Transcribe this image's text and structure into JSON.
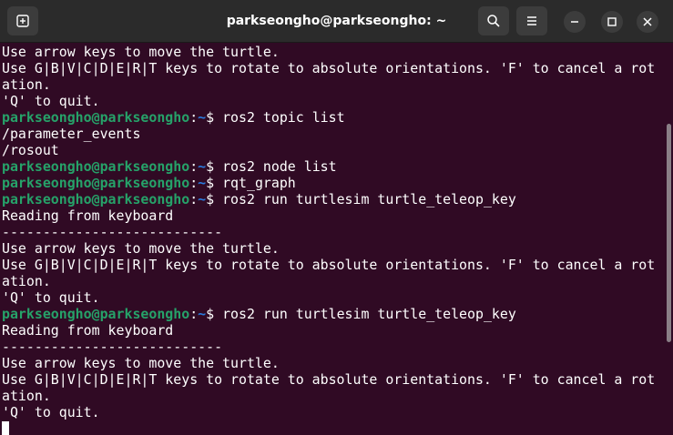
{
  "window": {
    "title": "parkseongho@parkseongho: ~"
  },
  "titlebar": {
    "buttons": [
      "new-tab-icon",
      "search-icon",
      "menu-icon",
      "minimize-icon",
      "maximize-icon",
      "close-icon"
    ]
  },
  "prompt": {
    "user": "parkseongho@parkseongho",
    "sep": ":",
    "path": "~",
    "symbol": "$ "
  },
  "colors": {
    "background": "#300a24",
    "prompt_user": "#26a269",
    "prompt_path": "#2a7bde",
    "text": "#ffffff"
  },
  "terminal": {
    "lines": [
      {
        "text": "Use arrow keys to move the turtle."
      },
      {
        "text": "Use G|B|V|C|D|E|R|T keys to rotate to absolute orientations. 'F' to cancel a rot"
      },
      {
        "text": "ation."
      },
      {
        "text": "'Q' to quit."
      },
      {
        "cmd": "ros2 topic list"
      },
      {
        "text": "/parameter_events"
      },
      {
        "text": "/rosout"
      },
      {
        "cmd": "ros2 node list"
      },
      {
        "cmd": "rqt_graph"
      },
      {
        "cmd": "ros2 run turtlesim turtle_teleop_key"
      },
      {
        "text": "Reading from keyboard"
      },
      {
        "text": "---------------------------"
      },
      {
        "text": "Use arrow keys to move the turtle."
      },
      {
        "text": "Use G|B|V|C|D|E|R|T keys to rotate to absolute orientations. 'F' to cancel a rot"
      },
      {
        "text": "ation."
      },
      {
        "text": "'Q' to quit."
      },
      {
        "cmd": "ros2 run turtlesim turtle_teleop_key"
      },
      {
        "text": "Reading from keyboard"
      },
      {
        "text": "---------------------------"
      },
      {
        "text": "Use arrow keys to move the turtle."
      },
      {
        "text": "Use G|B|V|C|D|E|R|T keys to rotate to absolute orientations. 'F' to cancel a rot"
      },
      {
        "text": "ation."
      },
      {
        "text": "'Q' to quit."
      }
    ]
  }
}
